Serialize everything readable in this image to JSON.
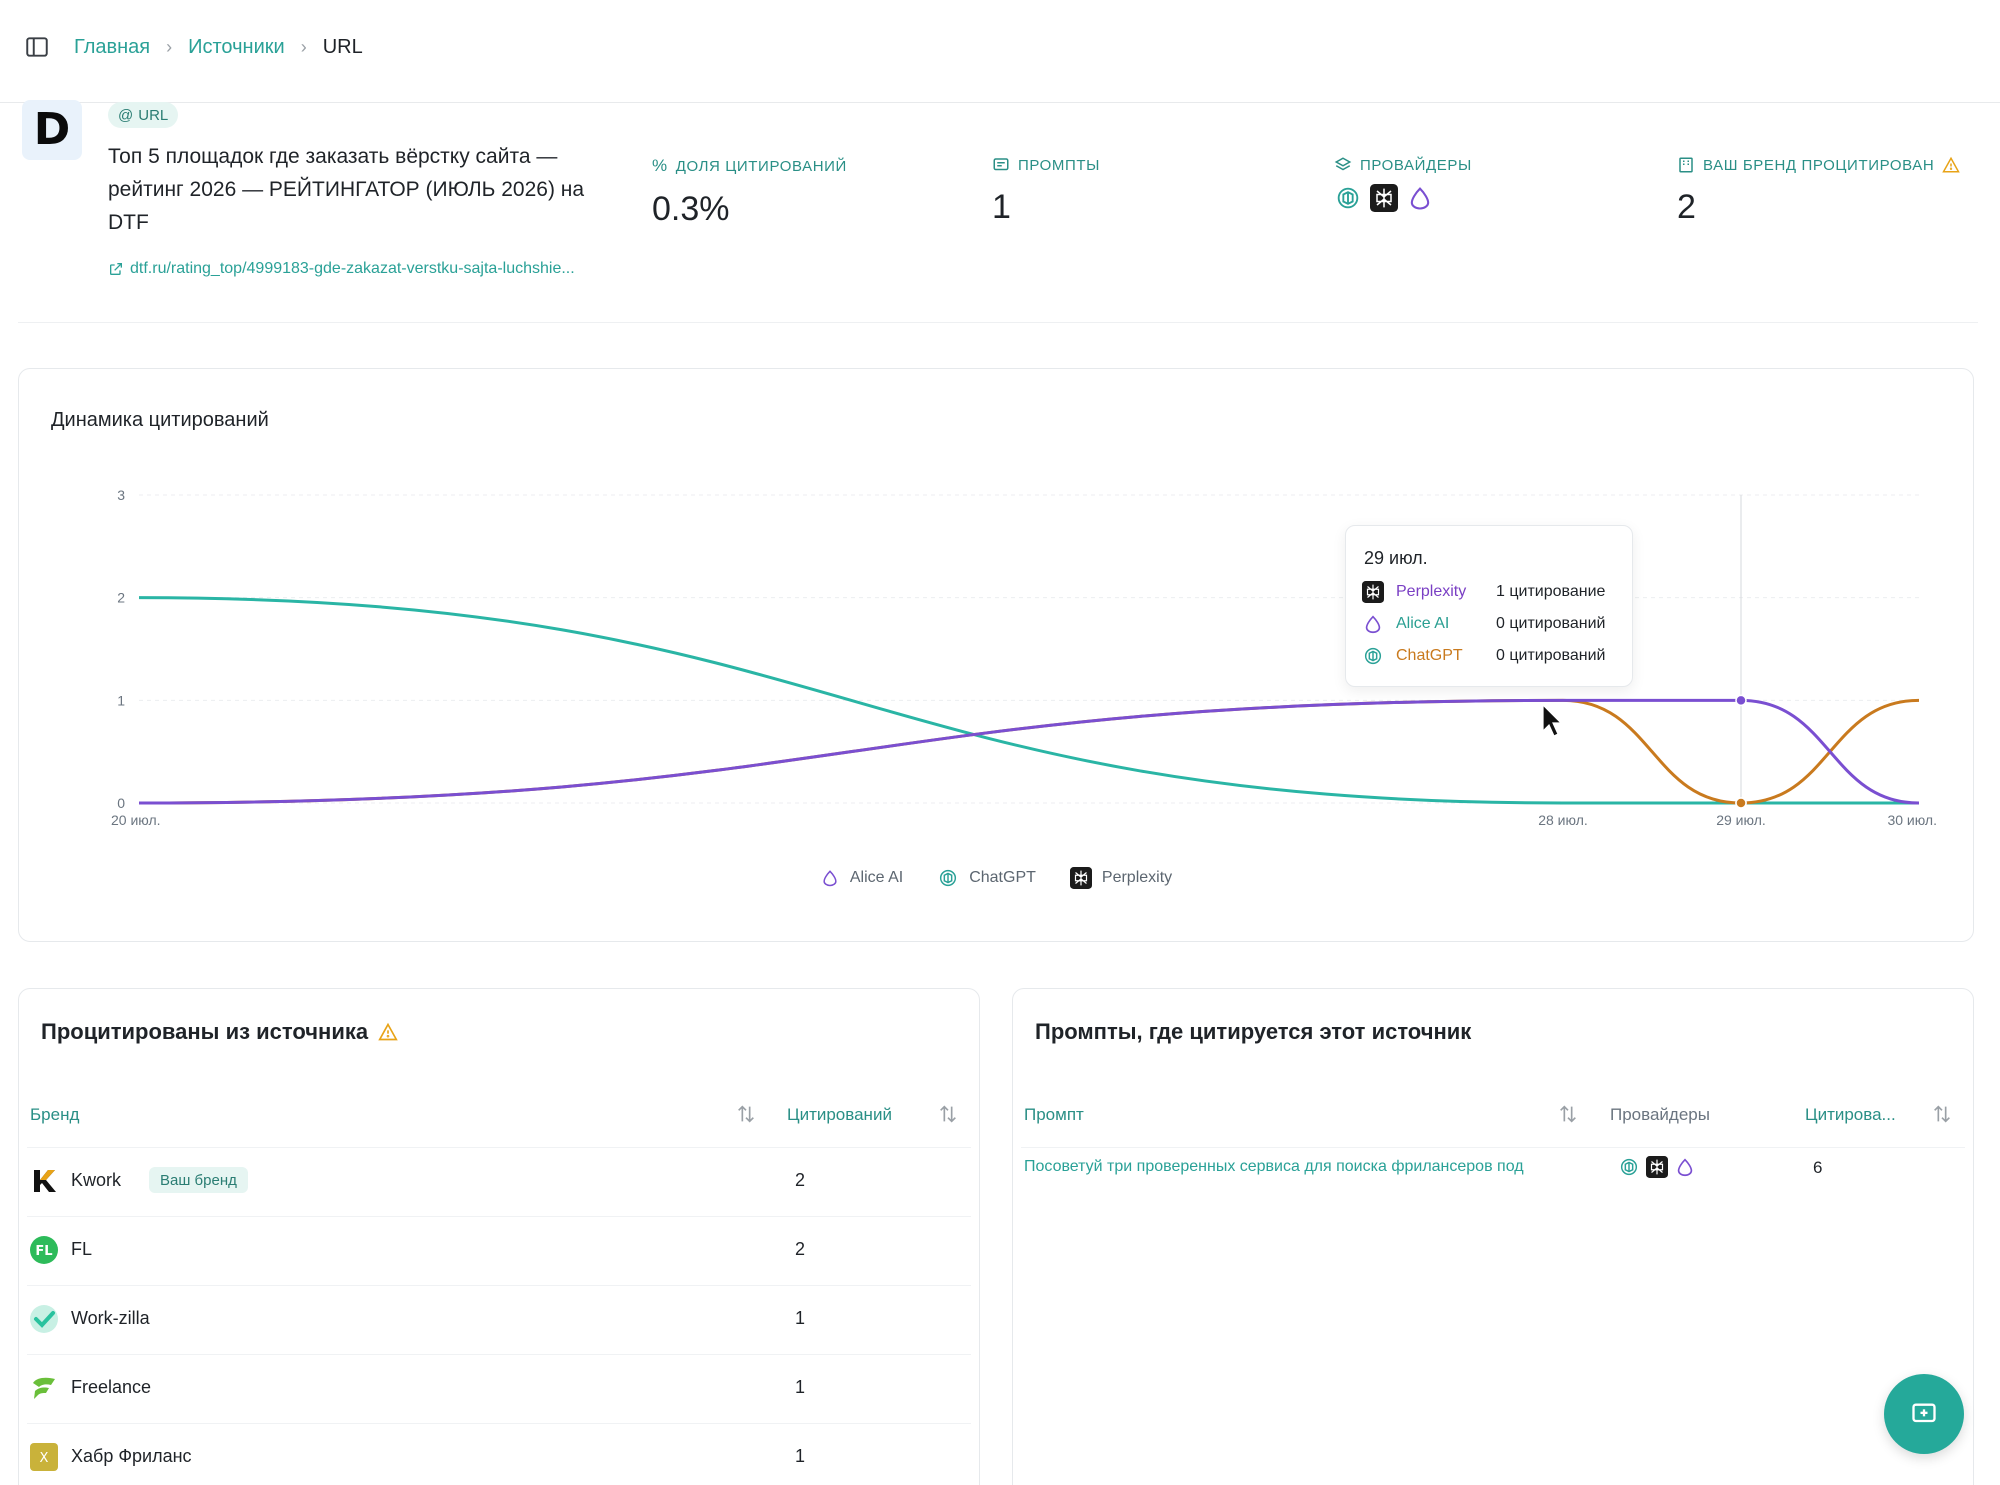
{
  "breadcrumb": {
    "home": "Главная",
    "sources": "Источники",
    "current": "URL"
  },
  "source": {
    "logo_letter": "D",
    "badge": "URL",
    "title": "Топ 5 площадок где заказать вёрстку сайта — рейтинг 2026 — РЕЙТИНГАТОР (ИЮЛЬ 2026) на DTF",
    "link": "dtf.ru/rating_top/4999183-gde-zakazat-verstku-sajta-luchshie..."
  },
  "metrics": {
    "share_label": "ДОЛЯ ЦИТИРОВАНИЙ",
    "share_value": "0.3%",
    "prompts_label": "ПРОМПТЫ",
    "prompts_value": "1",
    "providers_label": "ПРОВАЙДЕРЫ",
    "brand_label": "ВАШ БРЕНД ПРОЦИТИРОВАН",
    "brand_value": "2"
  },
  "chart_title": "Динамика цитирований",
  "chart_data": {
    "type": "line",
    "x": [
      "20 июл.",
      "28 июл.",
      "29 июл.",
      "30 июл."
    ],
    "ylim": [
      0,
      3
    ],
    "yticks": [
      "0",
      "1",
      "2",
      "3"
    ],
    "series": [
      {
        "name": "Alice AI",
        "color": "#2ab5a5",
        "values": [
          2,
          0,
          0,
          0
        ]
      },
      {
        "name": "ChatGPT",
        "color": "#c97a1e",
        "values": [
          0,
          1,
          0,
          1
        ]
      },
      {
        "name": "Perplexity",
        "color": "#7a4fd1",
        "values": [
          0,
          1,
          1,
          0
        ]
      }
    ],
    "legend_position": "bottom",
    "grid": true
  },
  "tooltip": {
    "date": "29 июл.",
    "rows": [
      {
        "name": "Perplexity",
        "value": "1 цитирование",
        "color": "#7a3fc4"
      },
      {
        "name": "Alice AI",
        "value": "0 цитирований",
        "color": "#2a9f92"
      },
      {
        "name": "ChatGPT",
        "value": "0 цитирований",
        "color": "#c97a1e"
      }
    ]
  },
  "legend": [
    "Alice AI",
    "ChatGPT",
    "Perplexity"
  ],
  "cited_table": {
    "title": "Процитированы из источника",
    "col_brand": "Бренд",
    "col_count": "Цитирований",
    "rows": [
      {
        "name": "Kwork",
        "tag": "Ваш бренд",
        "count": "2",
        "logo_color": "#111111"
      },
      {
        "name": "FL",
        "tag": "",
        "count": "2",
        "logo_color": "#2dbb5a"
      },
      {
        "name": "Work-zilla",
        "tag": "",
        "count": "1",
        "logo_color": "#29c29e"
      },
      {
        "name": "Freelance",
        "tag": "",
        "count": "1",
        "logo_color": "#6abf3a"
      },
      {
        "name": "Хабр Фриланс",
        "tag": "",
        "count": "1",
        "logo_color": "#c9b23a"
      }
    ]
  },
  "prompts_table": {
    "title": "Промпты, где цитируется этот источник",
    "col_prompt": "Промпт",
    "col_providers": "Провайдеры",
    "col_count": "Цитирова...",
    "rows": [
      {
        "prompt": "Посоветуй три проверенных сервиса для поиска фрилансеров под",
        "count": "6"
      }
    ]
  },
  "icons": {
    "sidebar": "sidebar-toggle-icon",
    "providers": [
      "chatgpt-icon",
      "perplexity-icon",
      "alice-icon"
    ],
    "fab": "chat-plus-icon"
  }
}
